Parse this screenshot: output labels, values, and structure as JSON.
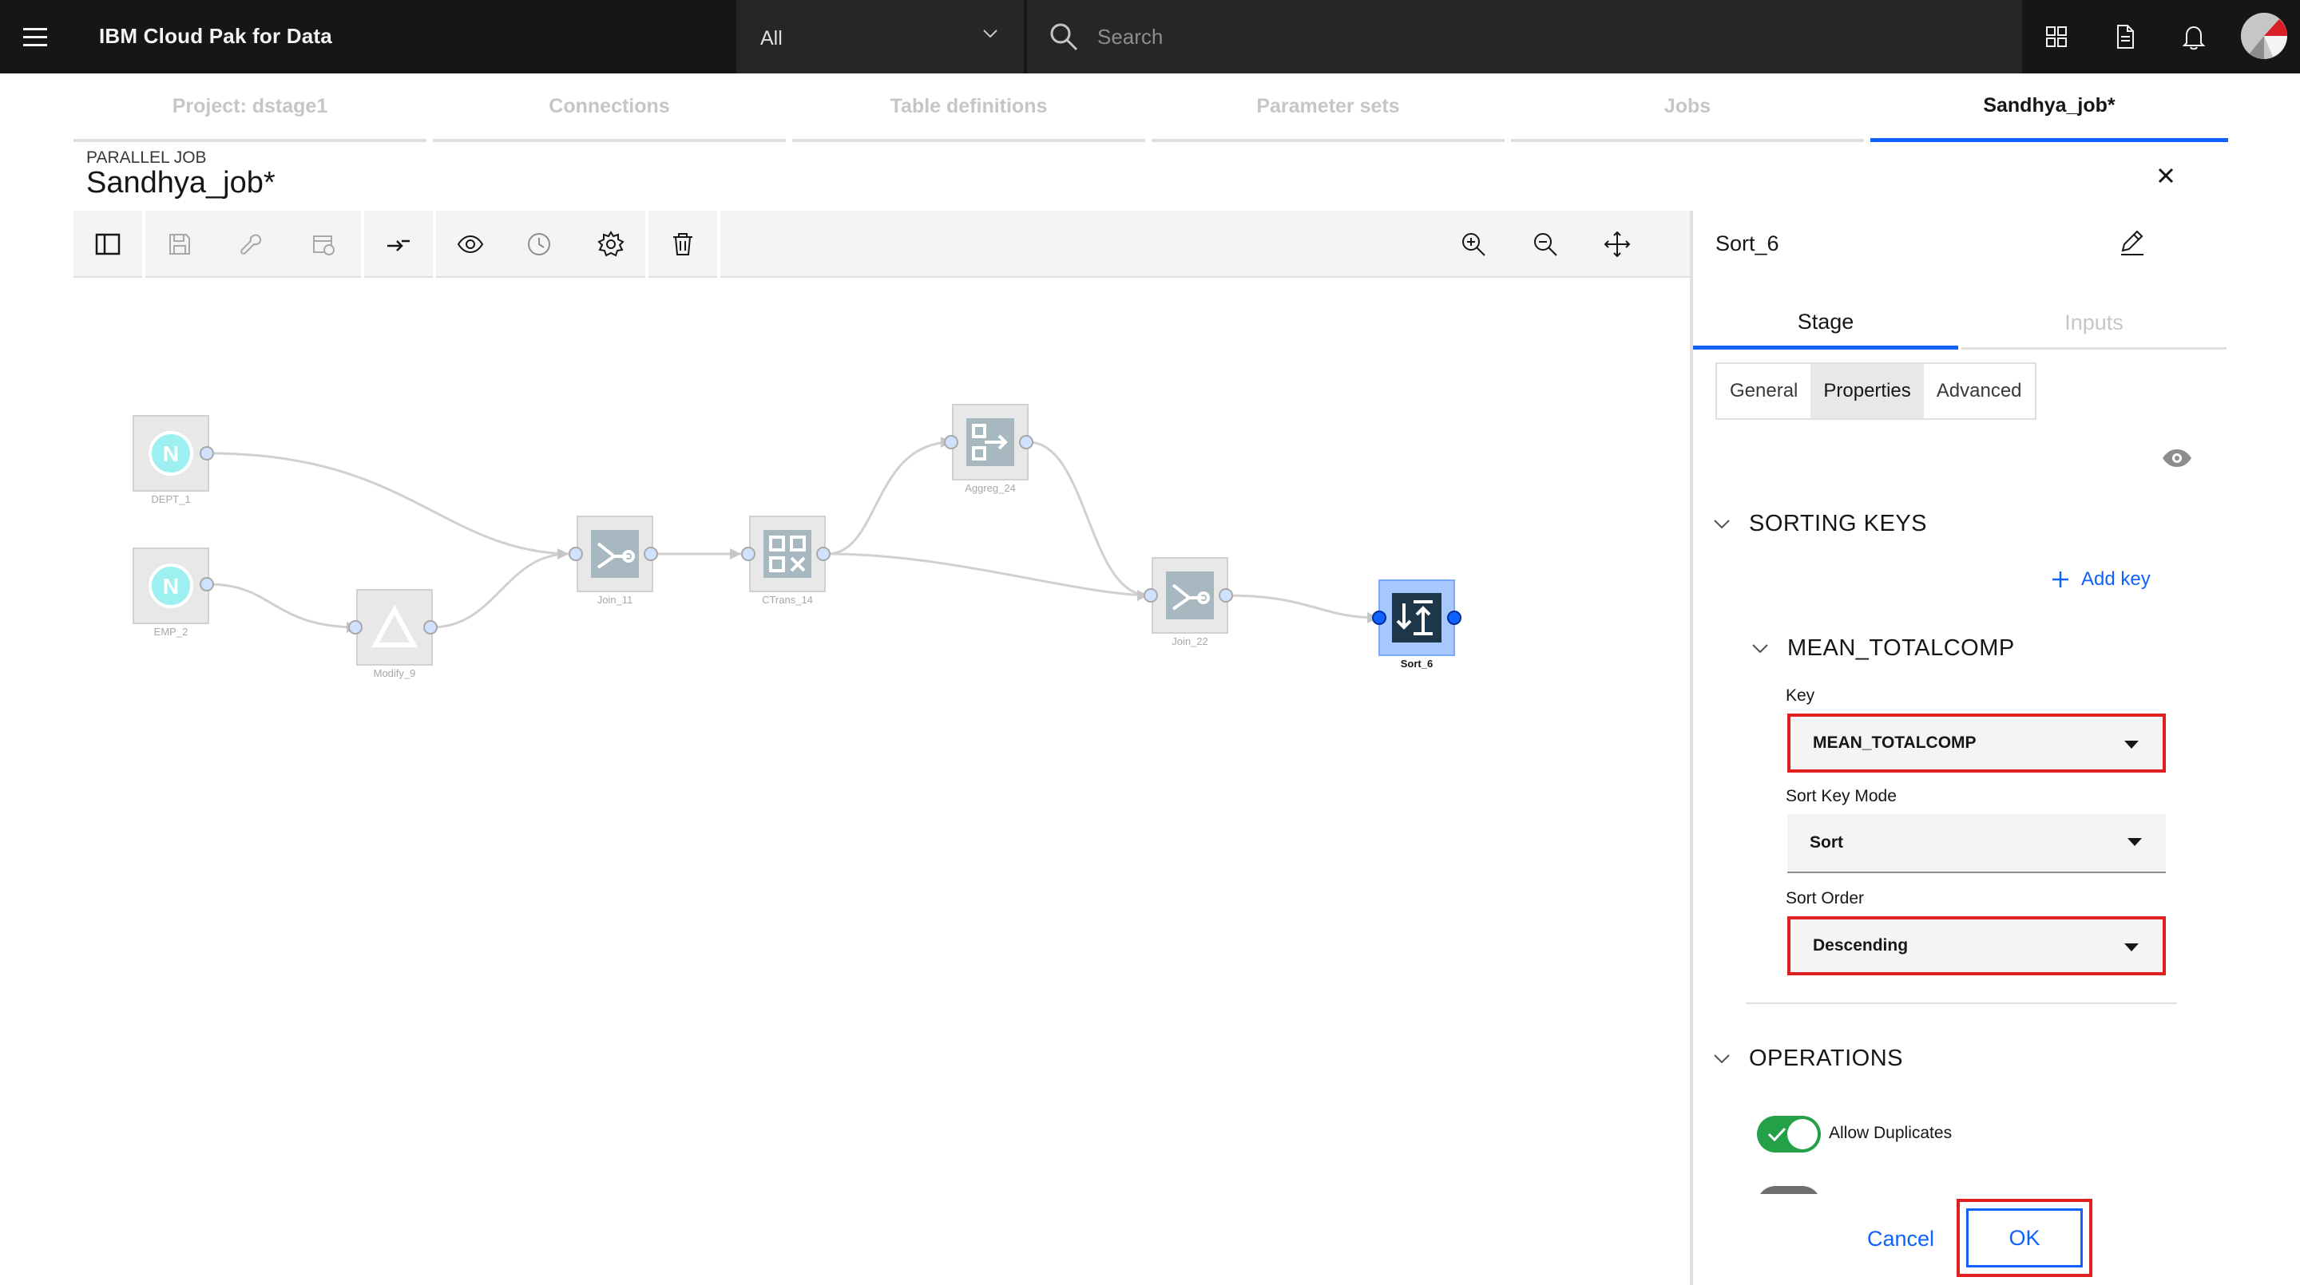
{
  "topbar": {
    "brand": "IBM Cloud Pak for Data",
    "scope": "All",
    "search_placeholder": "Search"
  },
  "project_tabs": [
    {
      "label": "Project: dstage1",
      "active": false
    },
    {
      "label": "Connections",
      "active": false
    },
    {
      "label": "Table definitions",
      "active": false
    },
    {
      "label": "Parameter sets",
      "active": false
    },
    {
      "label": "Jobs",
      "active": false
    },
    {
      "label": "Sandhya_job*",
      "active": true
    }
  ],
  "job": {
    "type": "PARALLEL JOB",
    "name": "Sandhya_job*"
  },
  "canvas": {
    "nodes": [
      {
        "label": "DEPT_1",
        "icon": "netezza-icon"
      },
      {
        "label": "EMP_2",
        "icon": "netezza-icon"
      },
      {
        "label": "Modify_9",
        "icon": "modify-icon"
      },
      {
        "label": "Join_11",
        "icon": "join-icon"
      },
      {
        "label": "CTrans_14",
        "icon": "transformer-icon"
      },
      {
        "label": "Aggreg_24",
        "icon": "aggregator-icon"
      },
      {
        "label": "Join_22",
        "icon": "join-icon"
      },
      {
        "label": "Sort_6",
        "icon": "sort-icon"
      }
    ]
  },
  "panel": {
    "stage_name": "Sort_6",
    "tabs": [
      "Stage",
      "Inputs"
    ],
    "subtabs": [
      "General",
      "Properties",
      "Advanced"
    ],
    "sorting_keys": {
      "title": "SORTING KEYS",
      "add_key": "Add key",
      "key_group": "MEAN_TOTALCOMP",
      "key_label": "Key",
      "key_value": "MEAN_TOTALCOMP",
      "mode_label": "Sort Key Mode",
      "mode_value": "Sort",
      "order_label": "Sort Order",
      "order_value": "Descending"
    },
    "operations": {
      "title": "OPERATIONS",
      "allow_duplicates": "Allow Duplicates"
    },
    "cancel": "Cancel",
    "ok": "OK"
  },
  "colors": {
    "accent": "#0f62fe",
    "highlight": "#e02020",
    "toggle_on": "#24a148",
    "topbar": "#161616"
  }
}
